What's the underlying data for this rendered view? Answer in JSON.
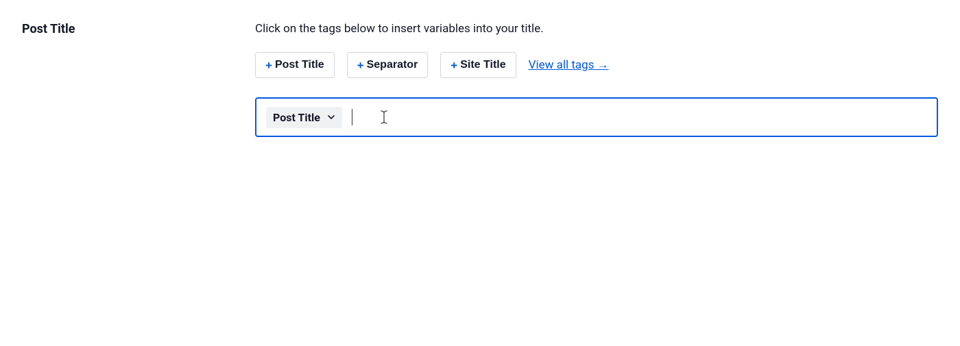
{
  "label": "Post Title",
  "helpText": "Click on the tags below to insert variables into your title.",
  "tagButtons": [
    {
      "label": "Post Title"
    },
    {
      "label": "Separator"
    },
    {
      "label": "Site Title"
    }
  ],
  "viewAllLink": "View all tags →",
  "inputTokens": [
    {
      "label": "Post Title"
    }
  ]
}
